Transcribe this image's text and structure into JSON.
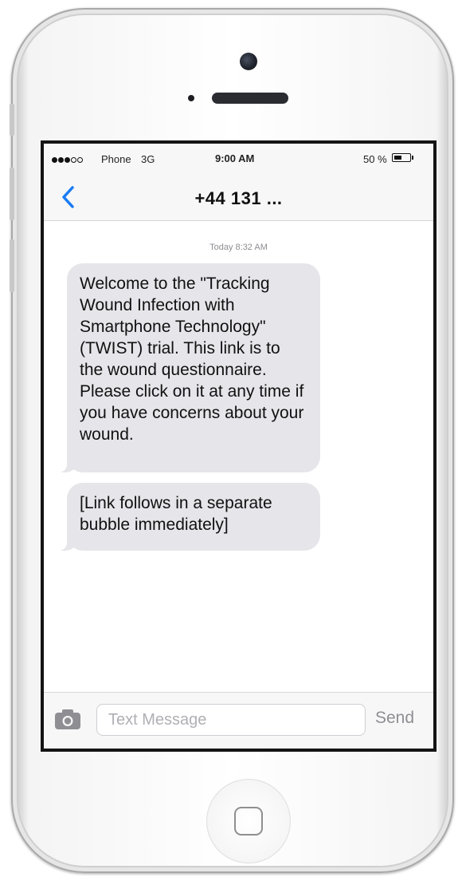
{
  "status_bar": {
    "signal_bars_total": 5,
    "signal_bars_filled": 3,
    "carrier": "Phone",
    "network": "3G",
    "time": "9:00 AM",
    "battery_percent": "50 %",
    "battery_level": 0.5
  },
  "nav": {
    "back_icon": "chevron-left-icon",
    "contact": "+44 131 ...",
    "accent_color": "#1a7cf5"
  },
  "thread": {
    "timestamp": "Today 8:32 AM",
    "messages": [
      {
        "text": "Welcome to the \"Tracking Wound Infection with Smartphone Technology\" (TWIST) trial. This link is to the wound questionnaire. Please click on it at any time if you have concerns about your wound."
      },
      {
        "text": "[Link follows in a separate bubble immediately]"
      }
    ],
    "bubble_color": "#e5e5ea"
  },
  "input_bar": {
    "camera_icon": "camera-icon",
    "placeholder": "Text Message",
    "value": "",
    "send_label": "Send"
  },
  "device": {
    "home_button_icon": "home-button-icon"
  }
}
